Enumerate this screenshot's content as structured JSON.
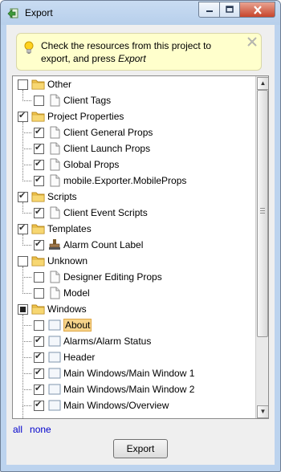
{
  "window": {
    "title": "Export",
    "buttons": [
      "minimize",
      "maximize",
      "close"
    ]
  },
  "hint": {
    "text": "Check the resources from this project to export, and press ",
    "emphasis": "Export"
  },
  "tree": {
    "rows": [
      {
        "label": "Other",
        "depth": 0,
        "state": "unchecked",
        "icon": "folder-icon"
      },
      {
        "label": "Client Tags",
        "depth": 1,
        "state": "unchecked",
        "icon": "document-icon"
      },
      {
        "label": "Project Properties",
        "depth": 0,
        "state": "checked",
        "icon": "folder-icon"
      },
      {
        "label": "Client General Props",
        "depth": 1,
        "state": "checked",
        "icon": "document-icon"
      },
      {
        "label": "Client Launch Props",
        "depth": 1,
        "state": "checked",
        "icon": "document-icon"
      },
      {
        "label": "Global Props",
        "depth": 1,
        "state": "checked",
        "icon": "document-icon"
      },
      {
        "label": "mobile.Exporter.MobileProps",
        "depth": 1,
        "state": "checked",
        "icon": "document-icon"
      },
      {
        "label": "Scripts",
        "depth": 0,
        "state": "checked",
        "icon": "folder-icon"
      },
      {
        "label": "Client Event Scripts",
        "depth": 1,
        "state": "checked",
        "icon": "document-icon"
      },
      {
        "label": "Templates",
        "depth": 0,
        "state": "checked",
        "icon": "folder-icon"
      },
      {
        "label": "Alarm Count Label",
        "depth": 1,
        "state": "checked",
        "icon": "stamp-icon"
      },
      {
        "label": "Unknown",
        "depth": 0,
        "state": "unchecked",
        "icon": "folder-icon"
      },
      {
        "label": "Designer Editing Props",
        "depth": 1,
        "state": "unchecked",
        "icon": "document-icon"
      },
      {
        "label": "Model",
        "depth": 1,
        "state": "unchecked",
        "icon": "document-icon"
      },
      {
        "label": "Windows",
        "depth": 0,
        "state": "partial",
        "icon": "folder-icon"
      },
      {
        "label": "About",
        "depth": 1,
        "state": "unchecked",
        "icon": "window-icon",
        "selected": true
      },
      {
        "label": "Alarms/Alarm Status",
        "depth": 1,
        "state": "checked",
        "icon": "window-icon"
      },
      {
        "label": "Header",
        "depth": 1,
        "state": "checked",
        "icon": "window-icon"
      },
      {
        "label": "Main Windows/Main Window 1",
        "depth": 1,
        "state": "checked",
        "icon": "window-icon"
      },
      {
        "label": "Main Windows/Main Window 2",
        "depth": 1,
        "state": "checked",
        "icon": "window-icon"
      },
      {
        "label": "Main Windows/Overview",
        "depth": 1,
        "state": "checked",
        "icon": "window-icon"
      }
    ]
  },
  "links": {
    "all": "all",
    "none": "none"
  },
  "export_button": "Export",
  "colors": {
    "hint_bg": "#ffffcc",
    "selection": "#f6d38a",
    "folder": "#f0c04a",
    "link": "#0000cc"
  }
}
